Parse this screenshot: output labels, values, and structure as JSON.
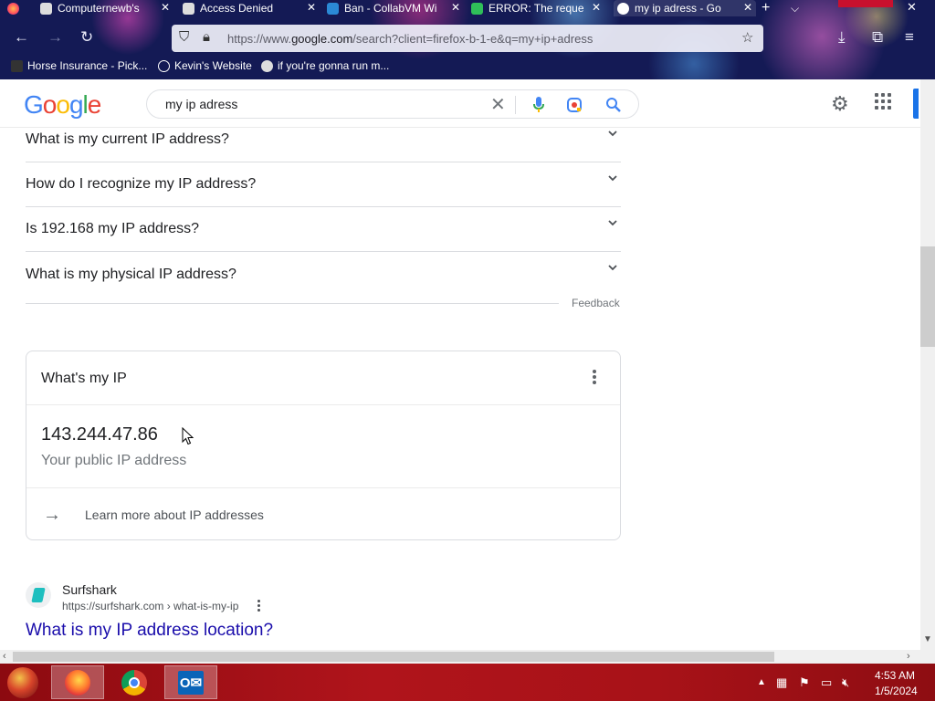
{
  "browser": {
    "tabs": [
      {
        "title": "Computernewb's",
        "active": false
      },
      {
        "title": "Access Denied",
        "active": false
      },
      {
        "title": "Ban - CollabVM Wi",
        "active": false
      },
      {
        "title": "ERROR: The reque",
        "active": false
      },
      {
        "title": "my ip adress - Go",
        "active": true
      }
    ],
    "url_prefix": "https://www.",
    "url_domain": "google.com",
    "url_path": "/search?client=firefox-b-1-e&q=my+ip+adress",
    "bookmarks": [
      {
        "label": "Horse Insurance - Pick..."
      },
      {
        "label": "Kevin's Website"
      },
      {
        "label": "if you're gonna run m..."
      }
    ]
  },
  "google": {
    "logo_letters": [
      "G",
      "o",
      "o",
      "g",
      "l",
      "e"
    ],
    "logo_colors": [
      "#4285F4",
      "#EA4335",
      "#FBBC05",
      "#4285F4",
      "#34A853",
      "#EA4335"
    ],
    "search_query": "my ip adress"
  },
  "related_questions": [
    {
      "question": "What is my current IP address?"
    },
    {
      "question": "How do I recognize my IP address?"
    },
    {
      "question": "Is 192.168 my IP address?"
    },
    {
      "question": "What is my physical IP address?"
    }
  ],
  "feedback_label": "Feedback",
  "ip_card": {
    "title": "What's my IP",
    "ip_address": "143.244.47.86",
    "caption": "Your public IP address",
    "learn_more": "Learn more about IP addresses"
  },
  "result": {
    "site_name": "Surfshark",
    "site_url": "https://surfshark.com › what-is-my-ip",
    "title": "What is my IP address location?"
  },
  "taskbar": {
    "apps": [
      {
        "name": "firefox",
        "active": true
      },
      {
        "name": "chrome",
        "active": false
      },
      {
        "name": "outlook",
        "active": true
      }
    ],
    "time": "4:53 AM",
    "date": "1/5/2024"
  }
}
